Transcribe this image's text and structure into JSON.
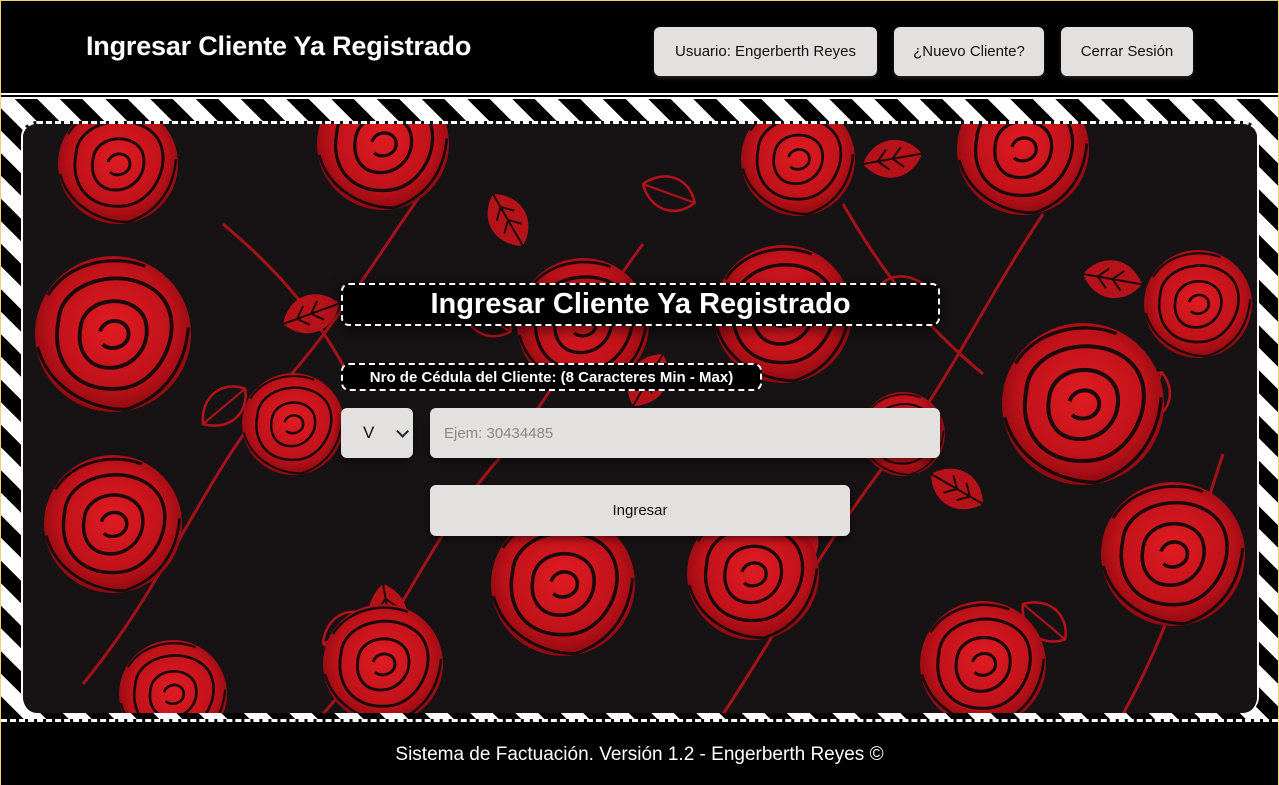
{
  "header": {
    "title": "Ingresar Cliente Ya Registrado",
    "buttons": {
      "user": "Usuario: Engerberth Reyes",
      "new_client": "¿Nuevo Cliente?",
      "logout": "Cerrar Sesión"
    }
  },
  "form": {
    "title": "Ingresar Cliente Ya Registrado",
    "cedula_label": "Nro de Cédula del Cliente: (8 Caracteres Min - Max)",
    "doc_type_selected": "V",
    "cedula_placeholder": "Ejem: 30434485",
    "cedula_value": "",
    "submit_label": "Ingresar"
  },
  "footer": {
    "text": "Sistema de Factuación. Versión 1.2 - Engerberth Reyes ©"
  },
  "colors": {
    "page_bg": "#000000",
    "button_bg": "#e3e0e0",
    "rose_red": "#c8141c",
    "panel_bg": "#171214"
  },
  "icons": {
    "select_arrow": "chevron-down-icon",
    "background_pattern": "rose-pattern"
  }
}
